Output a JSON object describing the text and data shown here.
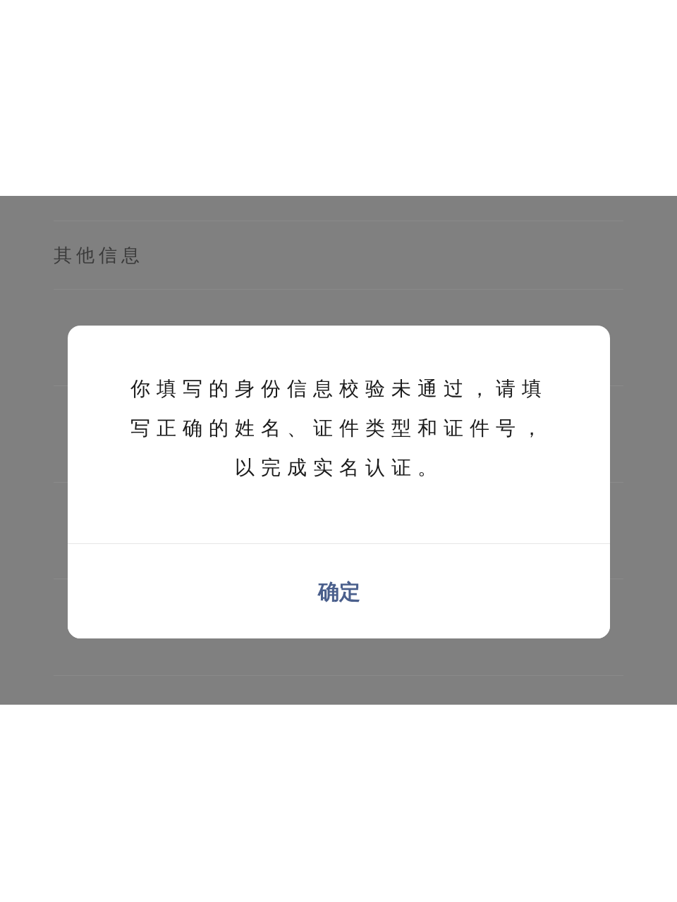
{
  "background_list": {
    "section_label": "其他信息"
  },
  "dialog": {
    "message": "你填写的身份信息校验未通过，请填写正确的姓名、证件类型和证件号，以完成实名认证。",
    "button": "确定"
  }
}
